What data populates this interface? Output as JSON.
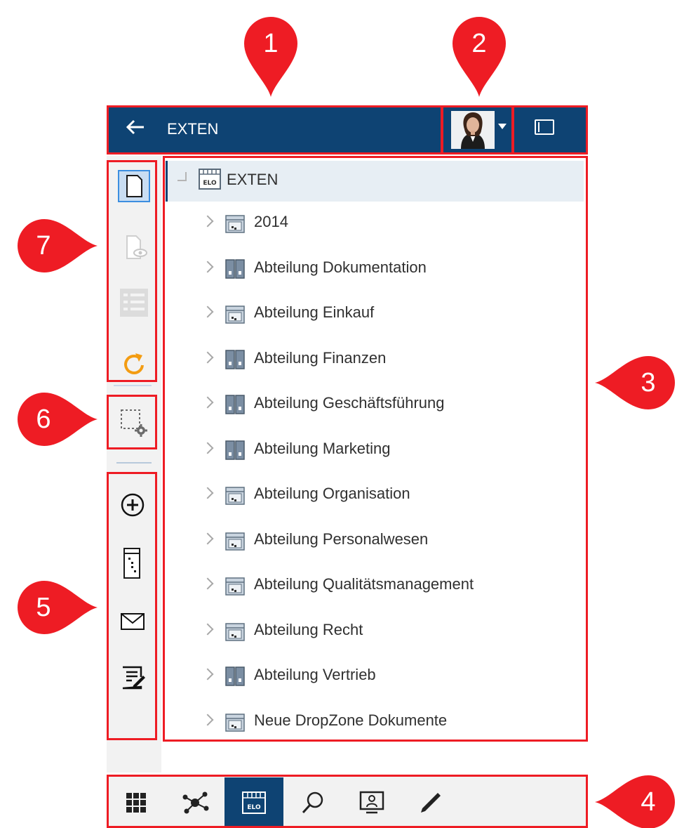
{
  "header": {
    "back_icon": "arrow-left-icon",
    "title": "EXTEN",
    "avatar_icon": "user-avatar",
    "panel_icon": "panel-toggle-icon"
  },
  "markers": [
    "1",
    "2",
    "3",
    "4",
    "5",
    "6",
    "7"
  ],
  "tree": {
    "root_label": "EXTEN",
    "items": [
      {
        "label": "2014",
        "icon": "folder-cabinet-icon"
      },
      {
        "label": "Abteilung Dokumentation",
        "icon": "folder-binder-icon"
      },
      {
        "label": "Abteilung Einkauf",
        "icon": "folder-cabinet-icon"
      },
      {
        "label": "Abteilung Finanzen",
        "icon": "folder-binder-icon"
      },
      {
        "label": "Abteilung Geschäftsführung",
        "icon": "folder-binder-icon"
      },
      {
        "label": "Abteilung Marketing",
        "icon": "folder-binder-icon"
      },
      {
        "label": "Abteilung Organisation",
        "icon": "folder-cabinet-icon"
      },
      {
        "label": "Abteilung Personalwesen",
        "icon": "folder-cabinet-icon"
      },
      {
        "label": "Abteilung Qualitätsmanagement",
        "icon": "folder-cabinet-icon"
      },
      {
        "label": "Abteilung Recht",
        "icon": "folder-cabinet-icon"
      },
      {
        "label": "Abteilung Vertrieb",
        "icon": "folder-binder-icon"
      },
      {
        "label": "Neue DropZone Dokumente",
        "icon": "folder-cabinet-icon"
      }
    ]
  },
  "left_toolbar": {
    "group7": [
      "document-icon",
      "preview-icon",
      "list-view-icon",
      "refresh-icon"
    ],
    "group6": [
      "selection-settings-icon"
    ],
    "group5": [
      "add-circle-icon",
      "filing-icon",
      "mail-icon",
      "edit-form-icon"
    ]
  },
  "bottom_nav": {
    "items": [
      "apps-grid-icon",
      "network-icon",
      "elo-archive-icon",
      "search-icon",
      "workspace-icon",
      "pen-icon"
    ],
    "active": "elo-archive-icon"
  },
  "colors": {
    "header": "#0e4373",
    "annotation_red": "#ee1c24",
    "toolbar_bg": "#f2f2f2",
    "selected_row": "#e7eef4",
    "refresh_orange": "#f39c12"
  }
}
